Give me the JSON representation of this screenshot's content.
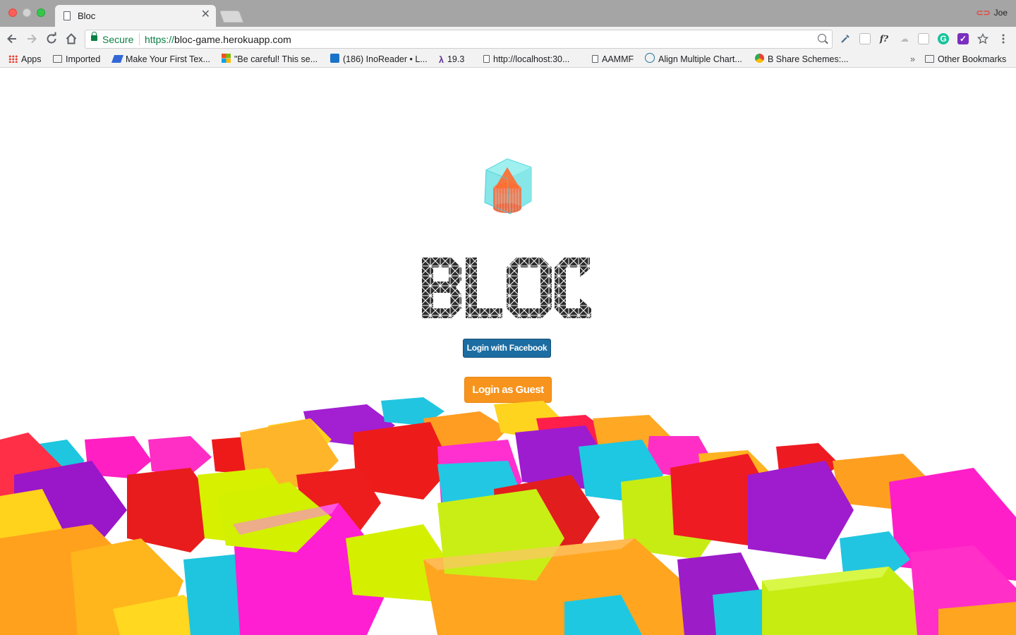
{
  "browser": {
    "tab": {
      "title": "Bloc",
      "close_glyph": "✕"
    },
    "profile": {
      "name": "Joe"
    },
    "toolbar": {
      "back_icon": "arrow-left-icon",
      "forward_icon": "arrow-right-icon",
      "reload_icon": "reload-icon",
      "home_icon": "home-icon",
      "security_label": "Secure",
      "url_protocol": "https://",
      "url_host": "bloc-game.herokuapp.com",
      "star_icon": "star-icon",
      "menu_icon": "kebab-menu-icon"
    },
    "bookmarks": [
      {
        "label": "Apps",
        "icon": "apps-grid-icon"
      },
      {
        "label": "Imported",
        "icon": "folder-icon"
      },
      {
        "label": "Make Your First Tex...",
        "icon": "layers-icon"
      },
      {
        "label": "\"Be careful! This se...",
        "icon": "microsoft-icon"
      },
      {
        "label": "(186) InoReader • L...",
        "icon": "inoreader-icon"
      },
      {
        "label": "19.3",
        "icon": "lambda-icon"
      },
      {
        "label": "http://localhost:30...",
        "icon": "page-icon"
      },
      {
        "label": "AAMMF",
        "icon": "page-icon"
      },
      {
        "label": "Align Multiple Chart...",
        "icon": "wordpress-icon"
      },
      {
        "label": "B Share Schemes:...",
        "icon": "chrome-icon"
      }
    ],
    "bookmarks_overflow": "»",
    "other_bookmarks": "Other Bookmarks"
  },
  "page": {
    "logo_alt": "BLOC",
    "login_facebook": "Login with Facebook",
    "login_guest": "Login as Guest"
  },
  "colors": {
    "facebook_button": "#1c6da2",
    "guest_button": "#f7941d",
    "secure_green": "#0b8043",
    "block_magenta": "#ff1fc9",
    "block_lime": "#d4f000",
    "block_orange": "#ffa21c",
    "block_red": "#ee1e1e",
    "block_cyan": "#17c2df",
    "block_purple": "#9a17c9",
    "block_yellow": "#ffd21c"
  }
}
